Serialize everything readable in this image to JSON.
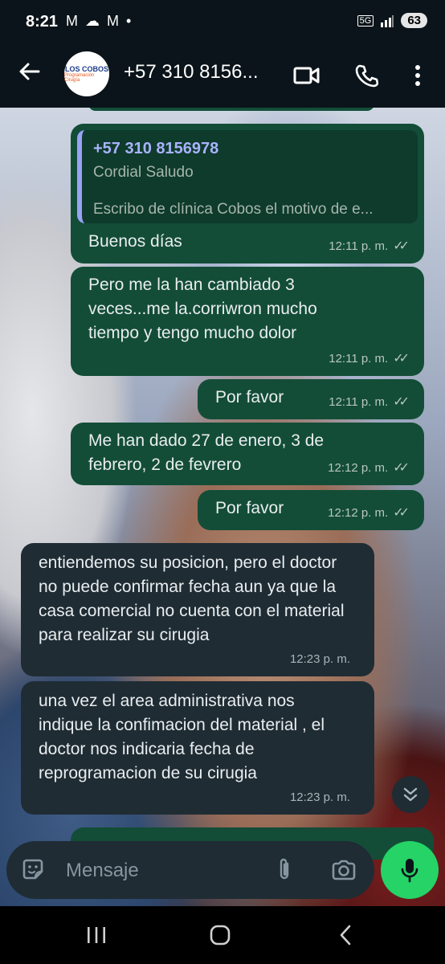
{
  "status_bar": {
    "time": "8:21",
    "left_icons": "M ☁ M •",
    "network": "5G",
    "battery": "63"
  },
  "header": {
    "title": "+57 310 8156...",
    "avatar_line1": "LOS COBOS",
    "avatar_line2": "Programación Cirugía"
  },
  "messages": [
    {
      "text": "Buenos días",
      "time": "12:11 p. m.",
      "direction": "out",
      "quote": {
        "author": "+57 310 8156978",
        "line1": "Cordial Saludo",
        "line2": "Escribo de clínica Cobos el motivo de e..."
      }
    },
    {
      "text": "Pero me la han cambiado 3 veces...me la.corriwron mucho tiempo y tengo mucho dolor",
      "time": "12:11 p. m.",
      "direction": "out"
    },
    {
      "text": "Por favor",
      "time": "12:11 p. m.",
      "direction": "out"
    },
    {
      "text": "Me han dado 27 de enero, 3 de febrero, 2 de fevrero",
      "time": "12:12 p. m.",
      "direction": "out"
    },
    {
      "text": "Por favor",
      "time": "12:12 p. m.",
      "direction": "out"
    },
    {
      "text": "entiendemos su posicion, pero el doctor no puede confirmar fecha aun ya que la casa comercial no cuenta con el material para realizar su cirugia",
      "time": "12:23 p. m.",
      "direction": "in"
    },
    {
      "text": "una vez el area administrativa nos indique la confimacion del material , el doctor nos indicaria fecha de reprogramacion de su cirugia",
      "time": "12:23 p. m.",
      "direction": "in"
    }
  ],
  "composer": {
    "placeholder": "Mensaje"
  },
  "colors": {
    "outgoing_bubble": "#134d37",
    "incoming_bubble": "#1f2c34",
    "mic_button": "#25d366",
    "quote_bar": "#9aa3f5"
  }
}
